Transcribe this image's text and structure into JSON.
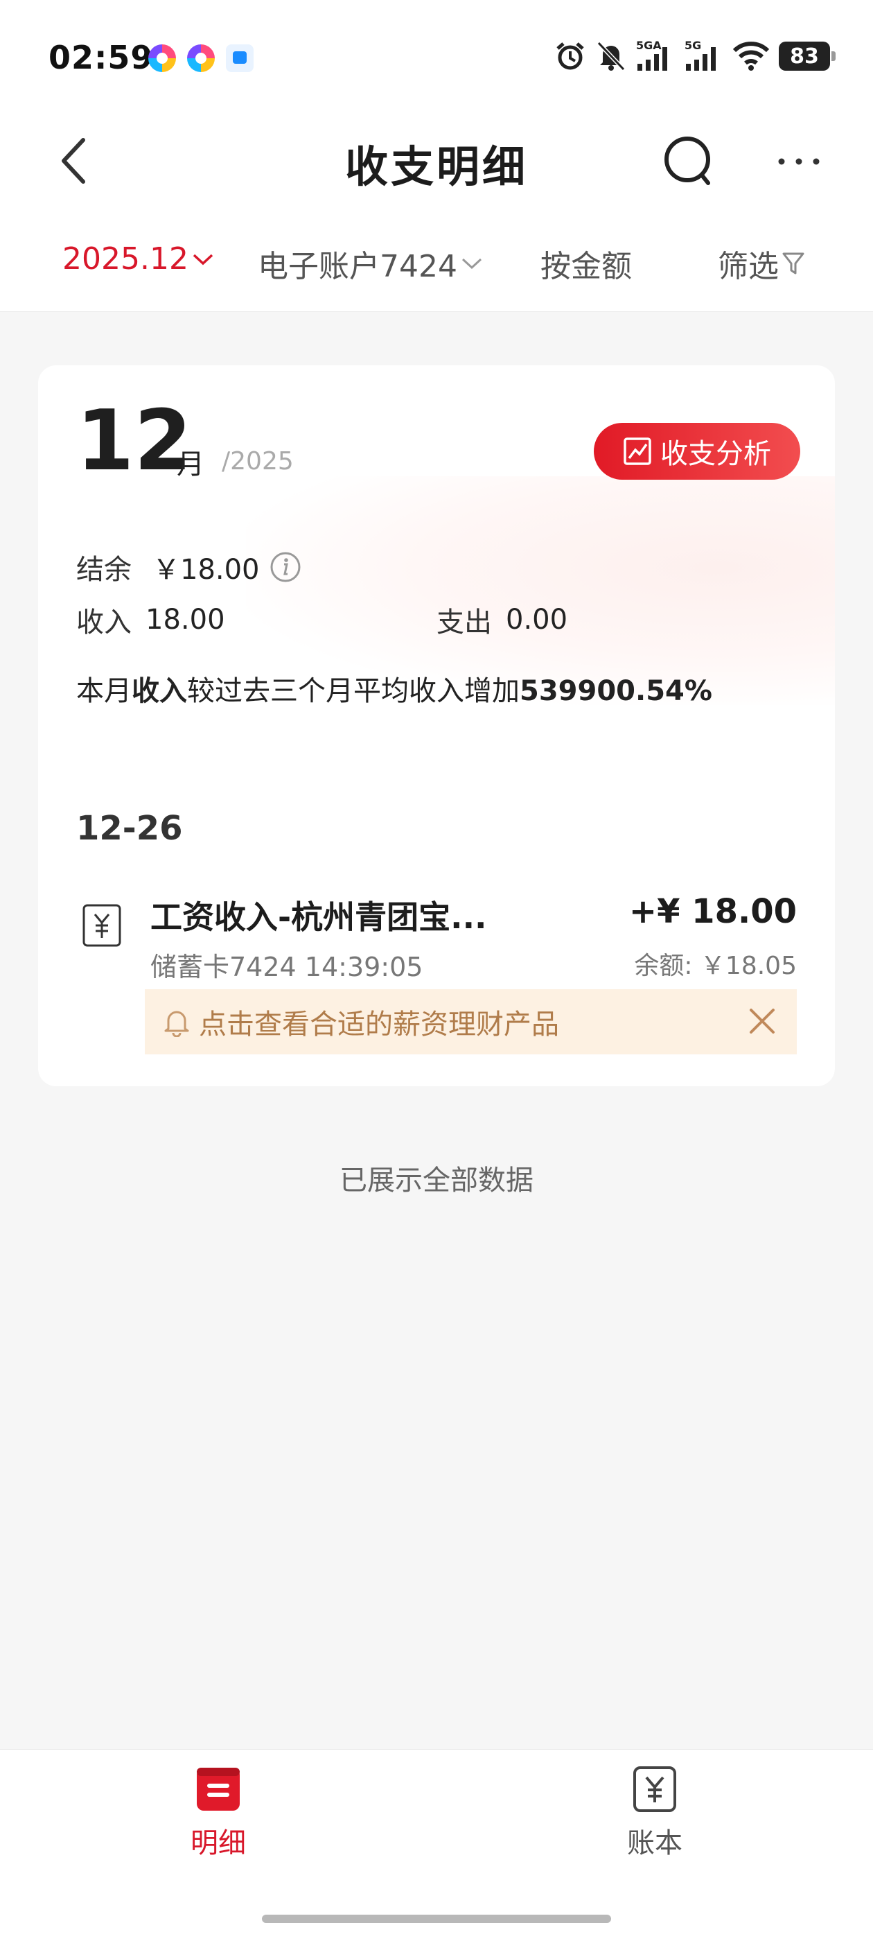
{
  "status_bar": {
    "time": "02:59",
    "signal_1_label": "5GA",
    "signal_2_label": "5G",
    "battery": "83"
  },
  "header": {
    "title": "收支明细"
  },
  "filters": {
    "month": "2025.12",
    "account": "电子账户7424",
    "by_amount": "按金额",
    "filter": "筛选"
  },
  "summary": {
    "month": "12",
    "month_unit": "月",
    "year": "/2025",
    "analysis_button": "收支分析",
    "balance_label": "结余",
    "balance_value": "￥18.00",
    "income_label": "收入",
    "income_value": "18.00",
    "expense_label": "支出",
    "expense_value": "0.00",
    "compare_prefix": "本月",
    "compare_bold": "收入",
    "compare_middle": "较过去三个月平均收入增加",
    "compare_percent": "539900.54%"
  },
  "transactions": {
    "date": "12-26",
    "items": [
      {
        "name": "工资收入-杭州青团宝...",
        "amount": "+¥ 18.00",
        "sub": "储蓄卡7424 14:39:05",
        "balance": "余额: ￥18.05"
      }
    ],
    "promo_text": "点击查看合适的薪资理财产品"
  },
  "footer_note": "已展示全部数据",
  "bottom_nav": {
    "tabs": [
      {
        "label": "明细",
        "icon": "list-icon"
      },
      {
        "label": "账本",
        "icon": "ledger-icon"
      }
    ]
  },
  "colors": {
    "accent": "#d8172a",
    "promo_bg": "#fdf1e2",
    "promo_text": "#b07c4a"
  }
}
